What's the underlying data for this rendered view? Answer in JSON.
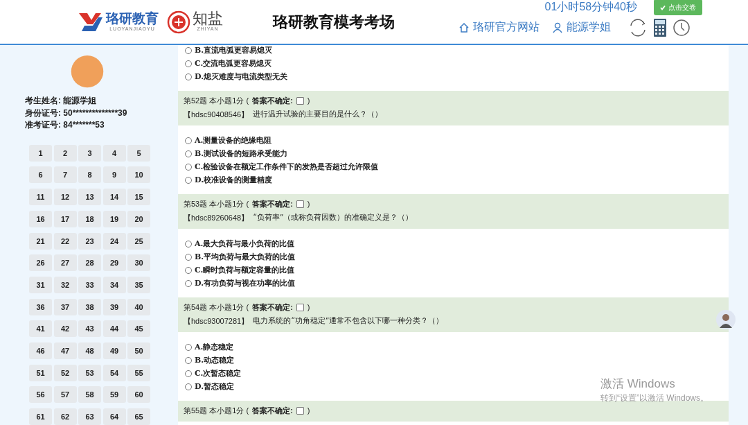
{
  "header": {
    "logos": [
      {
        "kind": "luoyan",
        "name": "珞研教育",
        "sub": "LUOYANJIAOYU"
      },
      {
        "kind": "zhiyan",
        "name": "知盐",
        "sub": "ZHIYAN"
      }
    ],
    "title": "珞研教育模考考场",
    "timer": "01小时58分钟40秒",
    "submit_button": "点击交卷",
    "links": [
      {
        "kind": "home",
        "label": "珞研官方网站"
      },
      {
        "kind": "user",
        "label": "能源学姐"
      }
    ]
  },
  "sidebar": {
    "candidate": [
      {
        "label": "考生姓名:",
        "value": "能源学姐"
      },
      {
        "label": "身份证号:",
        "value": "50**************39"
      },
      {
        "label": "准考证号:",
        "value": "84*******53"
      }
    ],
    "question_numbers": [
      "1",
      "2",
      "3",
      "4",
      "5",
      "6",
      "7",
      "8",
      "9",
      "10",
      "11",
      "12",
      "13",
      "14",
      "15",
      "16",
      "17",
      "18",
      "19",
      "20",
      "21",
      "22",
      "23",
      "24",
      "25",
      "26",
      "27",
      "28",
      "29",
      "30",
      "31",
      "32",
      "33",
      "34",
      "35",
      "36",
      "37",
      "38",
      "39",
      "40",
      "41",
      "42",
      "43",
      "44",
      "45",
      "46",
      "47",
      "48",
      "49",
      "50",
      "51",
      "52",
      "53",
      "54",
      "55",
      "56",
      "57",
      "58",
      "59",
      "60",
      "61",
      "62",
      "63",
      "64",
      "65"
    ]
  },
  "questions": [
    {
      "options": [
        {
          "text": "B.直流电弧更容易熄灭",
          "selected": false
        },
        {
          "text": "C.交流电弧更容易熄灭",
          "selected": false
        },
        {
          "text": "D.熄灭难度与电流类型无关",
          "selected": false
        }
      ]
    },
    {
      "title": "第52题 本小题1分 (",
      "uncertain_label": "答案不确定:",
      "uncertain_checked": false,
      "close": ")",
      "code": "【hdsc90408546】",
      "stem": "进行温升试验的主要目的是什么？（）",
      "options": [
        {
          "text": "A.测量设备的绝缘电阻",
          "selected": false
        },
        {
          "text": "B.测试设备的短路承受能力",
          "selected": false
        },
        {
          "text": "C.检验设备在额定工作条件下的发热是否超过允许限值",
          "selected": false
        },
        {
          "text": "D.校准设备的测量精度",
          "selected": false
        }
      ]
    },
    {
      "title": "第53题 本小题1分 (",
      "uncertain_label": "答案不确定:",
      "uncertain_checked": false,
      "close": ")",
      "code": "【hdsc89260648】",
      "stem": "“负荷率”（或称负荷因数）的准确定义是？（）",
      "options": [
        {
          "text": "A.最大负荷与最小负荷的比值",
          "selected": false
        },
        {
          "text": "B.平均负荷与最大负荷的比值",
          "selected": false
        },
        {
          "text": "C.瞬时负荷与额定容量的比值",
          "selected": false
        },
        {
          "text": "D.有功负荷与视在功率的比值",
          "selected": false
        }
      ]
    },
    {
      "title": "第54题 本小题1分 (",
      "uncertain_label": "答案不确定:",
      "uncertain_checked": false,
      "close": ")",
      "code": "【hdsc93007281】",
      "stem": "电力系统的“功角稳定”通常不包含以下哪一种分类？（）",
      "options": [
        {
          "text": "A.静态稳定",
          "selected": false
        },
        {
          "text": "B.动态稳定",
          "selected": false
        },
        {
          "text": "C.次暂态稳定",
          "selected": false
        },
        {
          "text": "D.暂态稳定",
          "selected": false
        }
      ]
    },
    {
      "title": "第55题 本小题1分 (",
      "uncertain_label": "答案不确定:",
      "uncertain_checked": false,
      "close": ")"
    }
  ],
  "os_overlay": {
    "title": "激活 Windows",
    "text": "转到“设置”以激活 Windows。"
  }
}
